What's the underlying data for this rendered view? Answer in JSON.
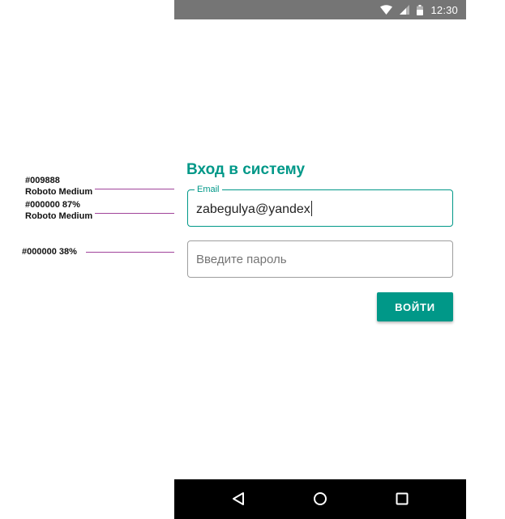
{
  "status_bar": {
    "time": "12:30",
    "icons": [
      "wifi-icon",
      "signal-icon",
      "battery-icon"
    ]
  },
  "login": {
    "title": "Вход в систему",
    "email": {
      "label": "Email",
      "value": "zabegulya@yandex"
    },
    "password": {
      "placeholder": "Введите пароль"
    },
    "submit_label": "ВОЙТИ"
  },
  "nav_bar": {
    "icons": [
      "back-icon",
      "home-icon",
      "recents-icon"
    ]
  },
  "annotations": {
    "label_color": "#009888",
    "label_font": "Roboto Medium",
    "input_color": "#000000 87%",
    "input_font": "Roboto Medium",
    "placeholder_color": "#000000 38%"
  },
  "colors": {
    "accent": "#009888",
    "status_bar": "#757575",
    "nav_bar": "#000000",
    "leader_line": "#a0449a"
  }
}
